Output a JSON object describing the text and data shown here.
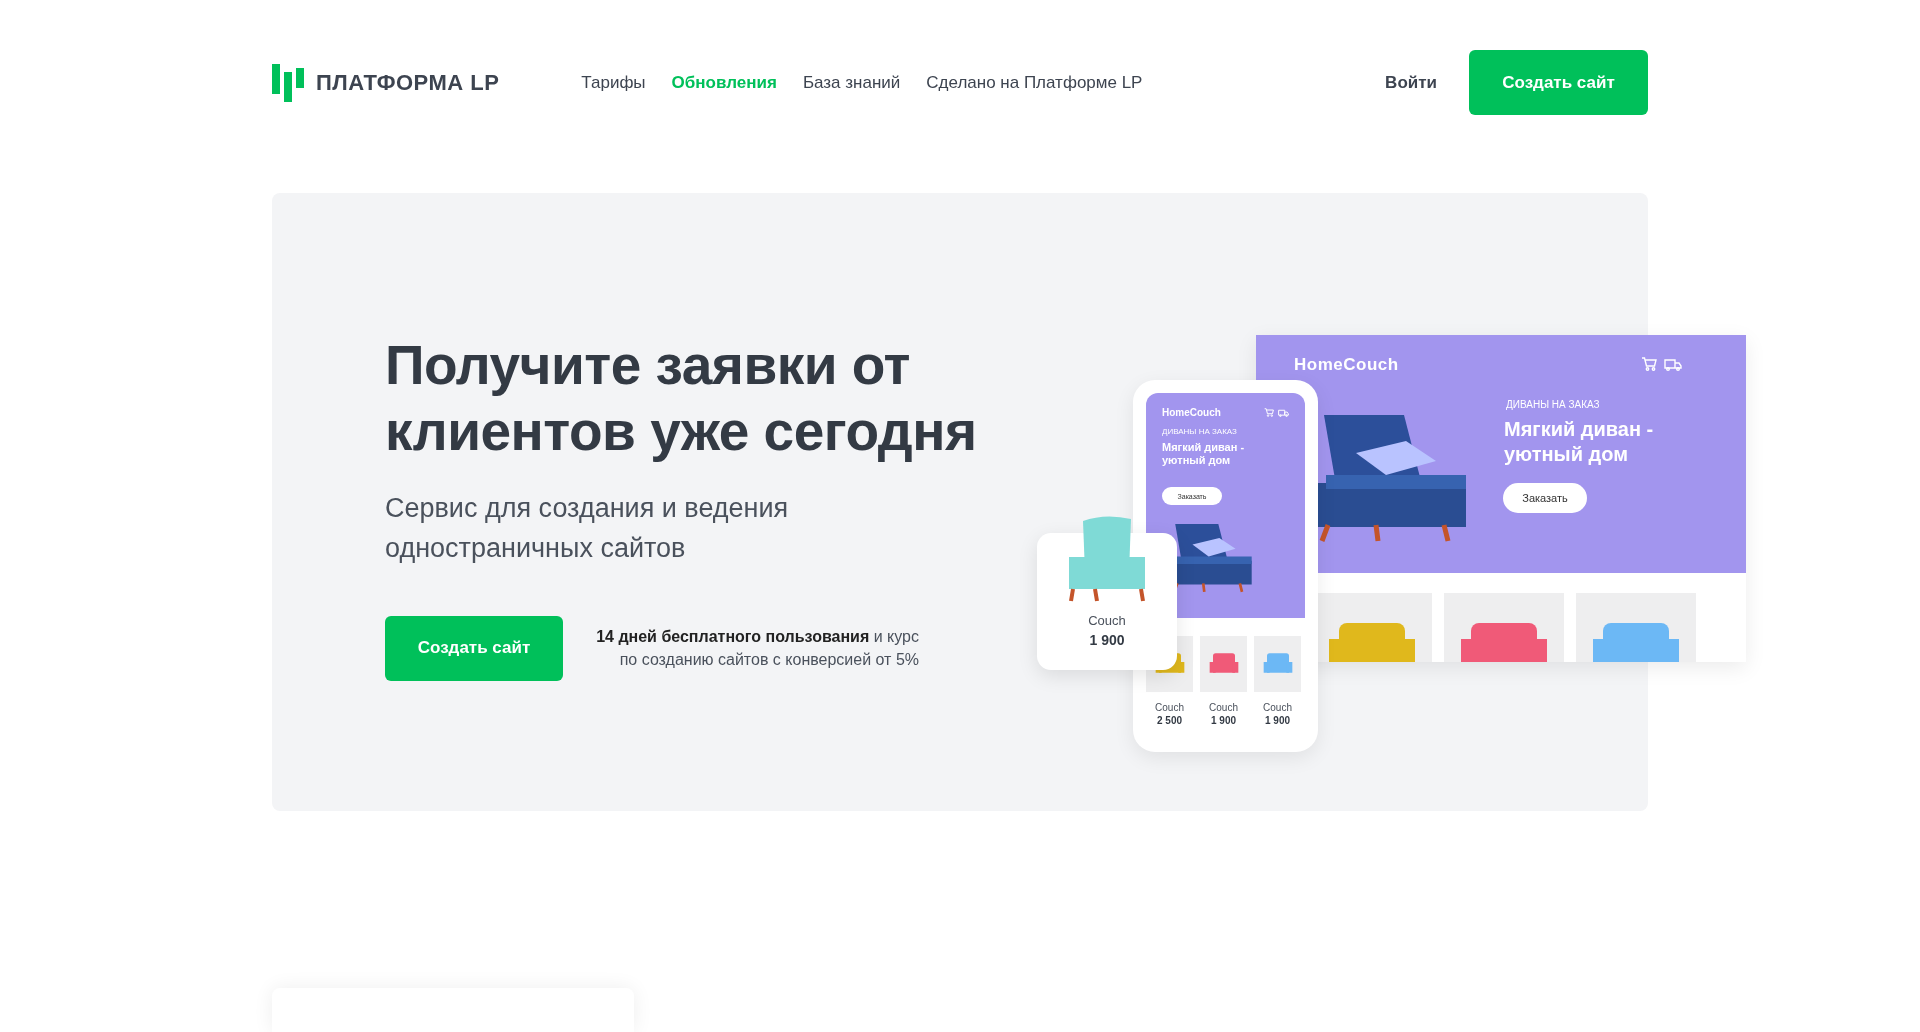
{
  "header": {
    "logo": "ПЛАТФОРМА LP",
    "nav": [
      {
        "label": "Тарифы",
        "selected": false
      },
      {
        "label": "Обновления",
        "selected": true
      },
      {
        "label": "База знаний",
        "selected": false
      },
      {
        "label": "Сделано на Платформе LP",
        "selected": false
      }
    ],
    "login": "Войти",
    "cta": "Создать сайт"
  },
  "hero": {
    "title_lines": [
      "Получите заявки от",
      "клиентов уже сегодня"
    ],
    "subtitle_lines": [
      "Сервис для создания и ведения",
      "одностраничных сайтов"
    ],
    "cta": "Создать сайт",
    "note": "**14 дней бесплатного пользования** и курс по созданию сайтов с конверсией от 5%"
  },
  "mockup": {
    "desktop": {
      "brand": "HomeCouch",
      "eyebrow": "ДИВАНЫ НА ЗАКАЗ",
      "headline_lines": [
        "Мягкий диван -",
        "уютный дом"
      ],
      "button": "Заказать",
      "products": [
        {
          "color": "#e0b81c"
        },
        {
          "color": "#f05a78"
        },
        {
          "color": "#6cb8f5"
        }
      ]
    },
    "phone": {
      "brand": "HomeCouch",
      "eyebrow": "ДИВАНЫ НА ЗАКАЗ",
      "headline_lines": [
        "Мягкий диван -",
        "уютный дом"
      ],
      "button": "Заказать",
      "products": [
        {
          "name": "Couch",
          "price": "2 500",
          "color": "#e0b81c"
        },
        {
          "name": "Couch",
          "price": "1 900",
          "color": "#f05a78"
        },
        {
          "name": "Couch",
          "price": "1 900",
          "color": "#6cb8f5"
        }
      ]
    },
    "card": {
      "name": "Couch",
      "price": "1 900",
      "color": "#7fdad6"
    }
  }
}
